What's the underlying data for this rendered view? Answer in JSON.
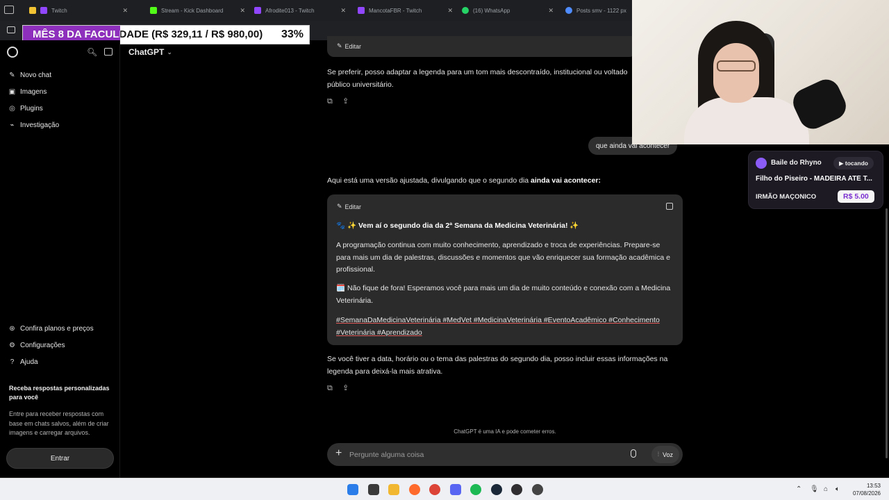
{
  "browser": {
    "tabs": [
      {
        "label": "Twitch",
        "fav_color": "#9146ff"
      },
      {
        "label": "Stream - Kick Dashboard",
        "fav_color": "#53fc18"
      },
      {
        "label": "Afrodite013 - Twitch",
        "fav_color": "#9146ff"
      },
      {
        "label": "MancotaFBR - Twitch",
        "fav_color": "#9146ff"
      },
      {
        "label": "(16) WhatsApp",
        "fav_color": "#25d366"
      },
      {
        "label": "Posts smv - 1122 px",
        "fav_color": "#4f8cff"
      }
    ]
  },
  "overlay": {
    "label": "MÊS 8 DA FACULDADE (R$ 329,11 / R$ 980,00)",
    "percent_label": "33%",
    "progress_fraction": 0.34,
    "fill_color": "#8e2fbd"
  },
  "sidebar": {
    "items": [
      {
        "label": "Novo chat",
        "icon": "edit-icon"
      },
      {
        "label": "Imagens",
        "icon": "image-icon"
      },
      {
        "label": "Plugins",
        "icon": "plugin-icon"
      },
      {
        "label": "Investigação",
        "icon": "telescope-icon"
      }
    ],
    "bottom_items": [
      {
        "label": "Confira planos e preços",
        "icon": "plans-icon"
      },
      {
        "label": "Configurações",
        "icon": "gear-icon"
      },
      {
        "label": "Ajuda",
        "icon": "help-icon"
      }
    ],
    "promo_title": "Receba respostas personalizadas para você",
    "promo_text": "Entre para receber respostas com base em chats salvos, além de criar imagens e carregar arquivos.",
    "login_label": "Entrar"
  },
  "header": {
    "model_label": "ChatGPT"
  },
  "chat": {
    "edit_label": "Editar",
    "prev_assistant_text": "Se preferir, posso adaptar a legenda para um tom mais descontraído, institucional ou voltado público universitário.",
    "user_message": "que ainda vai acontecer",
    "assistant_intro": "Aqui está uma versão ajustada, divulgando que o segundo dia",
    "assistant_intro_bold": "ainda vai acontecer:",
    "card": {
      "title": "🐾 ✨ Vem aí o segundo dia da 2ª Semana da Medicina Veterinária! ✨",
      "paragraph1": "A programação continua com muito conhecimento, aprendizado e troca de experiências. Prepare-se para mais um dia de palestras, discussões e momentos que vão enriquecer sua formação acadêmica e profissional.",
      "paragraph2": "🗓️ Não fique de fora! Esperamos você para mais um dia de muito conteúdo e conexão com a Medicina Veterinária.",
      "hashtags": "#SemanaDaMedicinaVeterinária #MedVet #MedicinaVeterinária #EventoAcadêmico #Conhecimento #Veterinária #Aprendizado"
    },
    "followup_text": "Se você tiver a data, horário ou o tema das palestras do segundo dia, posso incluir essas informações na legenda para deixá-la mais atrativa."
  },
  "composer": {
    "placeholder": "Pergunte alguma coisa",
    "voice_label": "Voz",
    "disclaimer": "ChatGPT é uma IA e pode cometer erros."
  },
  "music_widget": {
    "title": "Baile do Rhyno",
    "status": "▶ tocando",
    "song": "Filho do Piseiro - MADEIRA ATÉ T...",
    "requester": "IRMÃO MAÇONICO",
    "price": "R$ 5.00"
  },
  "taskbar": {
    "time": "13:53",
    "date": "07/08/2026",
    "apps": [
      {
        "icon": "windows-start-icon",
        "color": "#2b7de9"
      },
      {
        "icon": "file-explorer-icon",
        "color": "#3a3a3a"
      },
      {
        "icon": "folder-icon",
        "color": "#f2b731"
      },
      {
        "icon": "firefox-icon",
        "color": "#ff6b2c"
      },
      {
        "icon": "chrome-icon",
        "color": "#db4437"
      },
      {
        "icon": "discord-icon",
        "color": "#5865f2"
      },
      {
        "icon": "spotify-icon",
        "color": "#1db954"
      },
      {
        "icon": "steam-icon",
        "color": "#1b2838"
      },
      {
        "icon": "obs-icon",
        "color": "#302e31"
      },
      {
        "icon": "app-icon",
        "color": "#444444"
      }
    ]
  }
}
